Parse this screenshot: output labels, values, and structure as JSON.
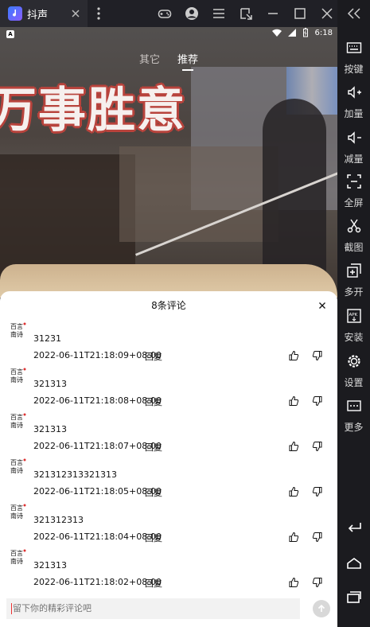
{
  "titlebar": {
    "app_name": "抖声",
    "icons": [
      "gamepad-icon",
      "account-icon",
      "menu-icon",
      "window-switch-icon",
      "minimize-icon",
      "maximize-icon",
      "close-icon"
    ]
  },
  "sidebar": {
    "items": [
      {
        "label": "按键",
        "icon": "keyboard-icon"
      },
      {
        "label": "加量",
        "icon": "volume-up-icon"
      },
      {
        "label": "减量",
        "icon": "volume-down-icon"
      },
      {
        "label": "全屏",
        "icon": "fullscreen-icon"
      },
      {
        "label": "截图",
        "icon": "scissors-icon"
      },
      {
        "label": "多开",
        "icon": "multi-open-icon"
      },
      {
        "label": "安装",
        "icon": "apk-install-icon"
      },
      {
        "label": "设置",
        "icon": "settings-icon"
      },
      {
        "label": "更多",
        "icon": "more-icon"
      }
    ],
    "bottom": [
      "back-icon",
      "home-icon",
      "recents-icon"
    ]
  },
  "phone": {
    "status_time": "6:18",
    "tabs": [
      {
        "label": "其它",
        "active": false
      },
      {
        "label": "推荐",
        "active": true
      }
    ],
    "video_caption": "万事胜意"
  },
  "comments_sheet": {
    "title": "8条评论",
    "reply_label": "回复",
    "comments": [
      {
        "text": "31231",
        "time": "2022-06-11T21:18:09+08:00"
      },
      {
        "text": "321313",
        "time": "2022-06-11T21:18:08+08:00"
      },
      {
        "text": "321313",
        "time": "2022-06-11T21:18:07+08:00"
      },
      {
        "text": "321312313321313",
        "time": "2022-06-11T21:18:05+08:00"
      },
      {
        "text": "321312313",
        "time": "2022-06-11T21:18:04+08:00"
      },
      {
        "text": "321313",
        "time": "2022-06-11T21:18:02+08:00"
      }
    ],
    "input_placeholder": "留下你的精彩评论吧"
  },
  "colors": {
    "emulator_bg": "#1b1b1f",
    "sheet_bg": "#ffffff",
    "accent_caption": "#b8433c"
  }
}
